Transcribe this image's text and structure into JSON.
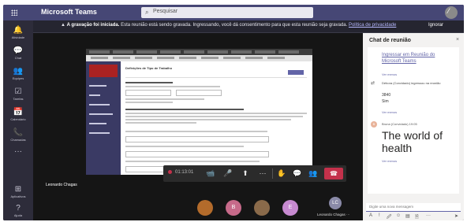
{
  "app": {
    "title": "Microsoft Teams"
  },
  "search": {
    "placeholder": "Pesquisar"
  },
  "user_avatar": {
    "initial": "⁄"
  },
  "rail": [
    {
      "label": "Atividade",
      "icon": "bell-icon",
      "glyph": "🔔"
    },
    {
      "label": "Chat",
      "icon": "chat-icon",
      "glyph": "💬"
    },
    {
      "label": "Equipes",
      "icon": "teams-icon",
      "glyph": "👥"
    },
    {
      "label": "Tarefas",
      "icon": "tasks-icon",
      "glyph": "☑"
    },
    {
      "label": "Calendário",
      "icon": "calendar-icon",
      "glyph": "📅"
    },
    {
      "label": "Chamadas",
      "icon": "phone-icon",
      "glyph": "📞"
    },
    {
      "label": "",
      "icon": "more-icon",
      "glyph": "···"
    },
    {
      "label": "Aplicativos",
      "icon": "apps-icon",
      "glyph": "⊞"
    },
    {
      "label": "Ajuda",
      "icon": "help-icon",
      "glyph": "?"
    }
  ],
  "banner": {
    "warning_glyph": "▲",
    "bold": "A gravação foi iniciada.",
    "text": " Esta reunião está sendo gravada. Ingressando, você dá consentimento para que esta reunião seja gravada. ",
    "link": "Política de privacidade",
    "dismiss": "Ignorar"
  },
  "shared_screen": {
    "title": "Definições de Tipo de Trabalho"
  },
  "stage": {
    "presenter_name": "Leonardo Chagas"
  },
  "controls": {
    "timer": "01:13:01",
    "buttons": [
      {
        "name": "camera-icon",
        "glyph": "📹"
      },
      {
        "name": "mic-icon",
        "glyph": "🎤"
      },
      {
        "name": "share-icon",
        "glyph": "⬆"
      },
      {
        "name": "more-icon",
        "glyph": "···"
      },
      {
        "name": "raise-hand-icon",
        "glyph": "✋"
      },
      {
        "name": "chat-icon",
        "glyph": "💬"
      },
      {
        "name": "participants-icon",
        "glyph": "👥"
      }
    ],
    "hangup_glyph": "☎"
  },
  "participants": [
    {
      "initial": "",
      "color": "#b36b2b"
    },
    {
      "initial": "B",
      "color": "#c76a8a"
    },
    {
      "initial": "",
      "color": "#8a6a4a"
    },
    {
      "initial": "E",
      "color": "#c78ad0"
    }
  ],
  "me": {
    "initials": "LC",
    "label": "Leonardo Chagas ···"
  },
  "chat": {
    "title": "Chat de reunião",
    "close": "×",
    "link": "Ingressar em Reunião do Microsoft Teams",
    "see_more_1": "Ver menos",
    "system_text": "Débora (Convidado) ingressou na reunião",
    "small_msg_1": "3840",
    "small_msg_2": "Sim",
    "see_more_2": "Ver menos",
    "sender_initial": "B",
    "sender_meta": "Bruna (Convidado)  19:05",
    "big_msg": "The world of health",
    "see_more_3": "Ver menos",
    "compose_placeholder": "Digite uma nova mensagem",
    "tools": [
      "A",
      "!",
      "🖉",
      "☺",
      "▤",
      "🗎",
      "···",
      "➤"
    ]
  },
  "colors": {
    "brand": "#464775",
    "accent": "#6264a7",
    "hangup": "#c4314b"
  }
}
